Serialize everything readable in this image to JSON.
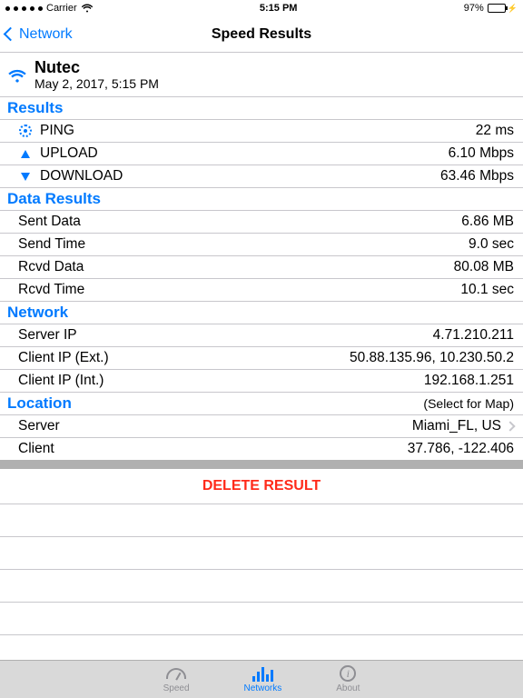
{
  "status": {
    "carrier": "Carrier",
    "time": "5:15 PM",
    "battery_pct": "97%",
    "charging": "⚡"
  },
  "nav": {
    "back": "Network",
    "title": "Speed Results"
  },
  "header": {
    "network_name": "Nutec",
    "timestamp": "May 2, 2017, 5:15 PM"
  },
  "sections": {
    "results": {
      "title": "Results",
      "ping": {
        "label": "PING",
        "value": "22 ms"
      },
      "upload": {
        "label": "UPLOAD",
        "value": "6.10 Mbps"
      },
      "download": {
        "label": "DOWNLOAD",
        "value": "63.46 Mbps"
      }
    },
    "data_results": {
      "title": "Data Results",
      "sent_data": {
        "label": "Sent Data",
        "value": "6.86 MB"
      },
      "send_time": {
        "label": "Send Time",
        "value": "9.0 sec"
      },
      "rcvd_data": {
        "label": "Rcvd Data",
        "value": "80.08 MB"
      },
      "rcvd_time": {
        "label": "Rcvd Time",
        "value": "10.1 sec"
      }
    },
    "network": {
      "title": "Network",
      "server_ip": {
        "label": "Server IP",
        "value": "4.71.210.211"
      },
      "client_ip_ext": {
        "label": "Client IP (Ext.)",
        "value": "50.88.135.96, 10.230.50.2"
      },
      "client_ip_int": {
        "label": "Client IP (Int.)",
        "value": "192.168.1.251"
      }
    },
    "location": {
      "title": "Location",
      "hint": "(Select for Map)",
      "server": {
        "label": "Server",
        "value": "Miami_FL, US"
      },
      "client": {
        "label": "Client",
        "value": "37.786, -122.406"
      }
    }
  },
  "delete_label": "DELETE RESULT",
  "tabs": {
    "speed": "Speed",
    "networks": "Networks",
    "about": "About"
  }
}
